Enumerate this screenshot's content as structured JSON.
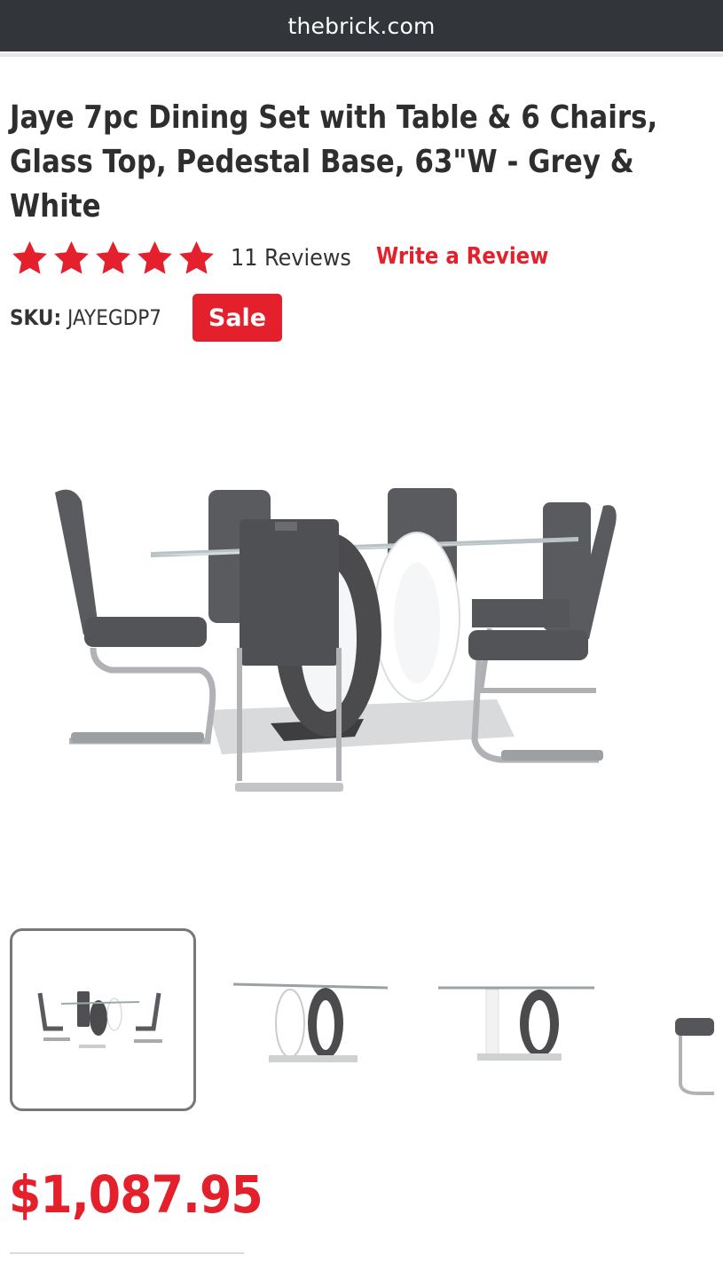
{
  "browser": {
    "url": "thebrick.com"
  },
  "product": {
    "title": "Jaye 7pc Dining Set with Table & 6 Chairs, Glass Top, Pedestal Base, 63\"W - Grey & White",
    "rating": 5,
    "reviews_label": "11 Reviews",
    "write_review_label": "Write a Review",
    "sku_label": "SKU:",
    "sku_value": "JAYEGDP7",
    "badge": "Sale",
    "price": "$1,087.95"
  },
  "gallery": {
    "main_image": "dining-set-image",
    "thumbnails": [
      "full-set",
      "table-angle",
      "table-side",
      "chair"
    ],
    "selected_index": 0
  },
  "colors": {
    "accent": "#e3202b",
    "header": "#323539",
    "chair": "#5a5b5e"
  }
}
